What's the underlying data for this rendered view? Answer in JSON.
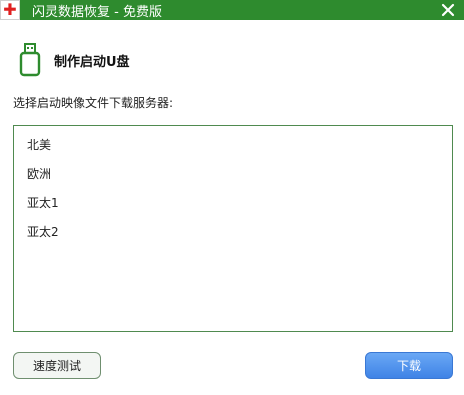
{
  "window": {
    "title": "闪灵数据恢复 - 免费版",
    "app_icon": "red-cross-logo",
    "close_glyph": "✕"
  },
  "header": {
    "icon": "usb-drive-icon",
    "title": "制作启动U盘"
  },
  "server_select": {
    "label": "选择启动映像文件下载服务器:",
    "items": [
      {
        "label": "北美"
      },
      {
        "label": "欧洲"
      },
      {
        "label": "亚太1"
      },
      {
        "label": "亚太2"
      }
    ]
  },
  "buttons": {
    "speed_test": "速度测试",
    "download": "下载"
  },
  "colors": {
    "titlebar": "#2e8b2e",
    "accent_green": "#2e8b2e",
    "download_button": "#4a8ef0"
  }
}
